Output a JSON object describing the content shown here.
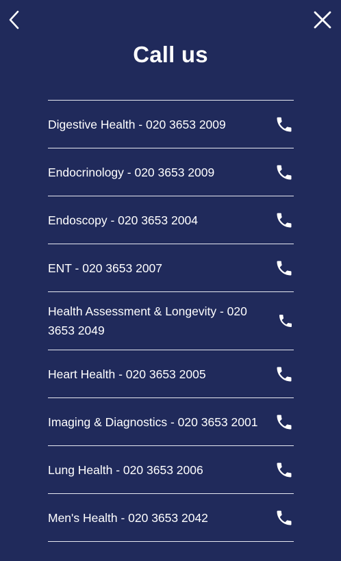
{
  "header": {
    "title": "Call us"
  },
  "icons": {
    "back": "chevron-left-icon",
    "close": "close-icon",
    "phone": "phone-icon"
  },
  "colors": {
    "background": "#202a5b",
    "text": "#ffffff",
    "divider": "#e8eaf2"
  },
  "departments": [
    {
      "label": "Digestive Health - 020 3653 2009"
    },
    {
      "label": "Endocrinology - 020 3653 2009"
    },
    {
      "label": "Endoscopy - 020 3653 2004"
    },
    {
      "label": "ENT - 020 3653 2007"
    },
    {
      "label": "Health Assessment & Longevity - 020 3653 2049"
    },
    {
      "label": "Heart Health - 020 3653 2005"
    },
    {
      "label": "Imaging & Diagnostics - 020 3653 2001"
    },
    {
      "label": "Lung Health - 020 3653 2006"
    },
    {
      "label": "Men's Health - 020 3653 2042"
    }
  ]
}
